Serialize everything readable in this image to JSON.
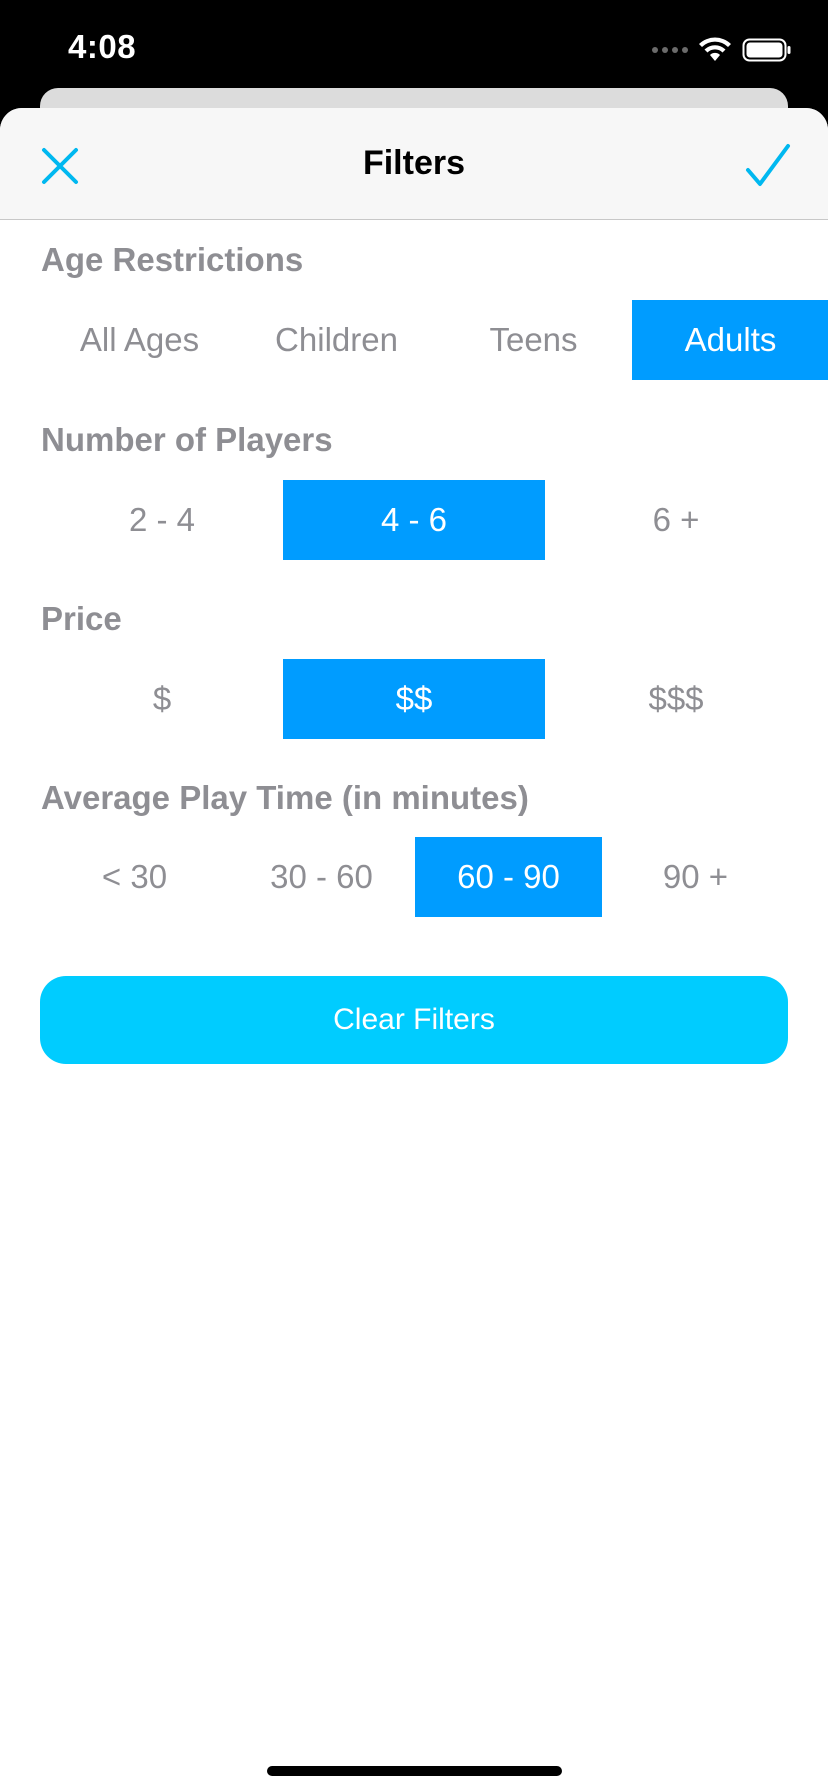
{
  "status_bar": {
    "time": "4:08",
    "icons": [
      "signal-icon",
      "wifi-icon",
      "battery-icon"
    ]
  },
  "nav": {
    "title": "Filters",
    "close_icon": "close-icon",
    "done_icon": "checkmark-icon"
  },
  "colors": {
    "accent": "#00ccff",
    "selected": "#009cff",
    "label": "#8e8e93"
  },
  "sections": {
    "age": {
      "title": "Age Restrictions",
      "options": [
        "All Ages",
        "Children",
        "Teens",
        "Adults"
      ],
      "selected": "Adults"
    },
    "players": {
      "title": "Number of Players",
      "options": [
        "2 - 4",
        "4 - 6",
        "6 +"
      ],
      "selected": "4 - 6"
    },
    "price": {
      "title": "Price",
      "options": [
        "$",
        "$$",
        "$$$"
      ],
      "selected": "$$"
    },
    "playtime": {
      "title": "Average Play Time (in minutes)",
      "options": [
        "< 30",
        "30 - 60",
        "60 - 90",
        "90 +"
      ],
      "selected": "60 - 90"
    }
  },
  "clear_button": {
    "label": "Clear Filters"
  }
}
